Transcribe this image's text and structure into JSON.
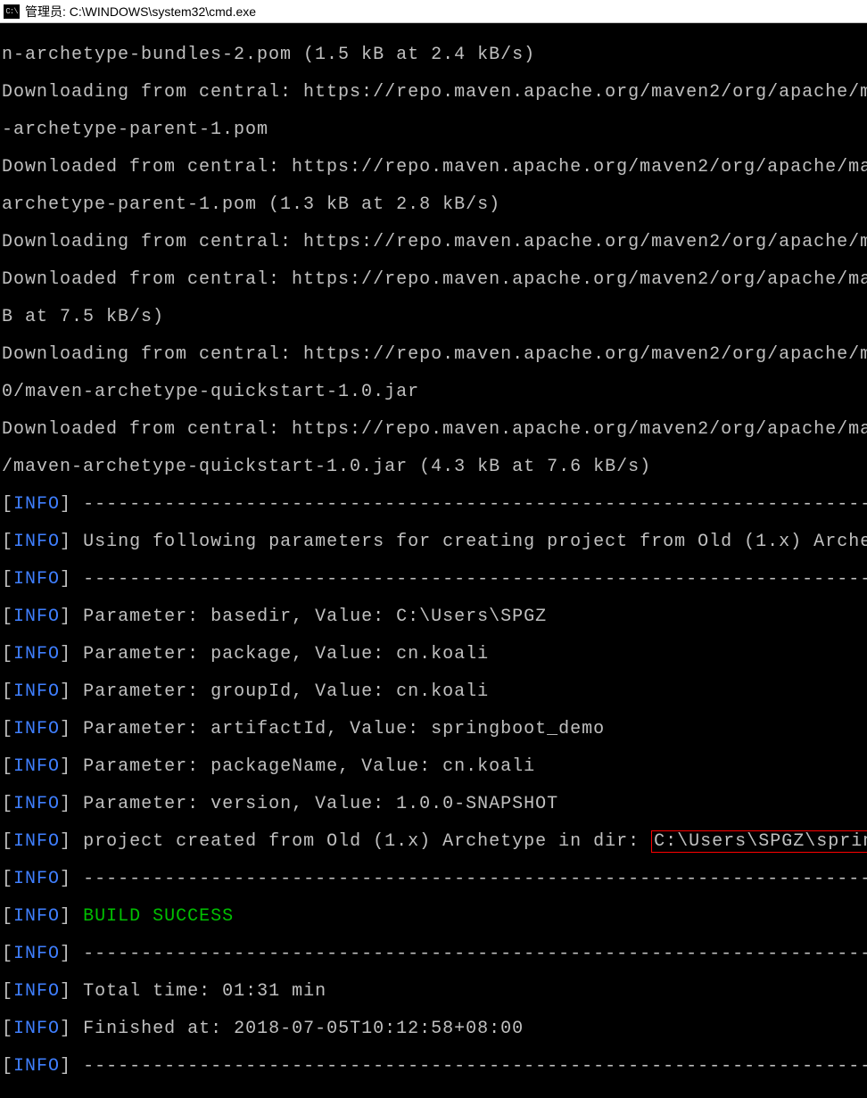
{
  "title": "管理员: C:\\WINDOWS\\system32\\cmd.exe",
  "lines": {
    "l0": "n-archetype-bundles-2.pom (1.5 kB at 2.4 kB/s)",
    "l1": "Downloading from central: https://repo.maven.apache.org/maven2/org/apache/maven/archetype",
    "l2": "-archetype-parent-1.pom",
    "l3": "Downloaded from central: https://repo.maven.apache.org/maven2/org/apache/maven/archetype/",
    "l4": "archetype-parent-1.pom (1.3 kB at 2.8 kB/s)",
    "l5": "Downloading from central: https://repo.maven.apache.org/maven2/org/apache/maven/maven-par",
    "l6": "Downloaded from central: https://repo.maven.apache.org/maven2/org/apache/maven/maven-pare",
    "l7": "B at 7.5 kB/s)",
    "l8": "Downloading from central: https://repo.maven.apache.org/maven2/org/apache/maven/archetype",
    "l9": "0/maven-archetype-quickstart-1.0.jar",
    "l10": "Downloaded from central: https://repo.maven.apache.org/maven2/org/apache/maven/archetypes",
    "l11": "/maven-archetype-quickstart-1.0.jar (4.3 kB at 7.6 kB/s)",
    "dashes": "--------------------------------------------------------------------------------",
    "info_label": "INFO",
    "i1": "Using following parameters for creating project from Old (1.x) Archetype: maven-ar",
    "i2": "Parameter: basedir, Value: C:\\Users\\SPGZ",
    "i3": "Parameter: package, Value: cn.koali",
    "i4": "Parameter: groupId, Value: cn.koali",
    "i5": "Parameter: artifactId, Value: springboot_demo",
    "i6": "Parameter: packageName, Value: cn.koali",
    "i7": "Parameter: version, Value: 1.0.0-SNAPSHOT",
    "i8a": "project created from Old (1.x) Archetype in dir: ",
    "i8b": "C:\\Users\\SPGZ\\springboot_demo",
    "build": "BUILD SUCCESS",
    "t1": "Total time: 01:31 min",
    "t2": "Finished at: 2018-07-05T10:12:58+08:00"
  }
}
